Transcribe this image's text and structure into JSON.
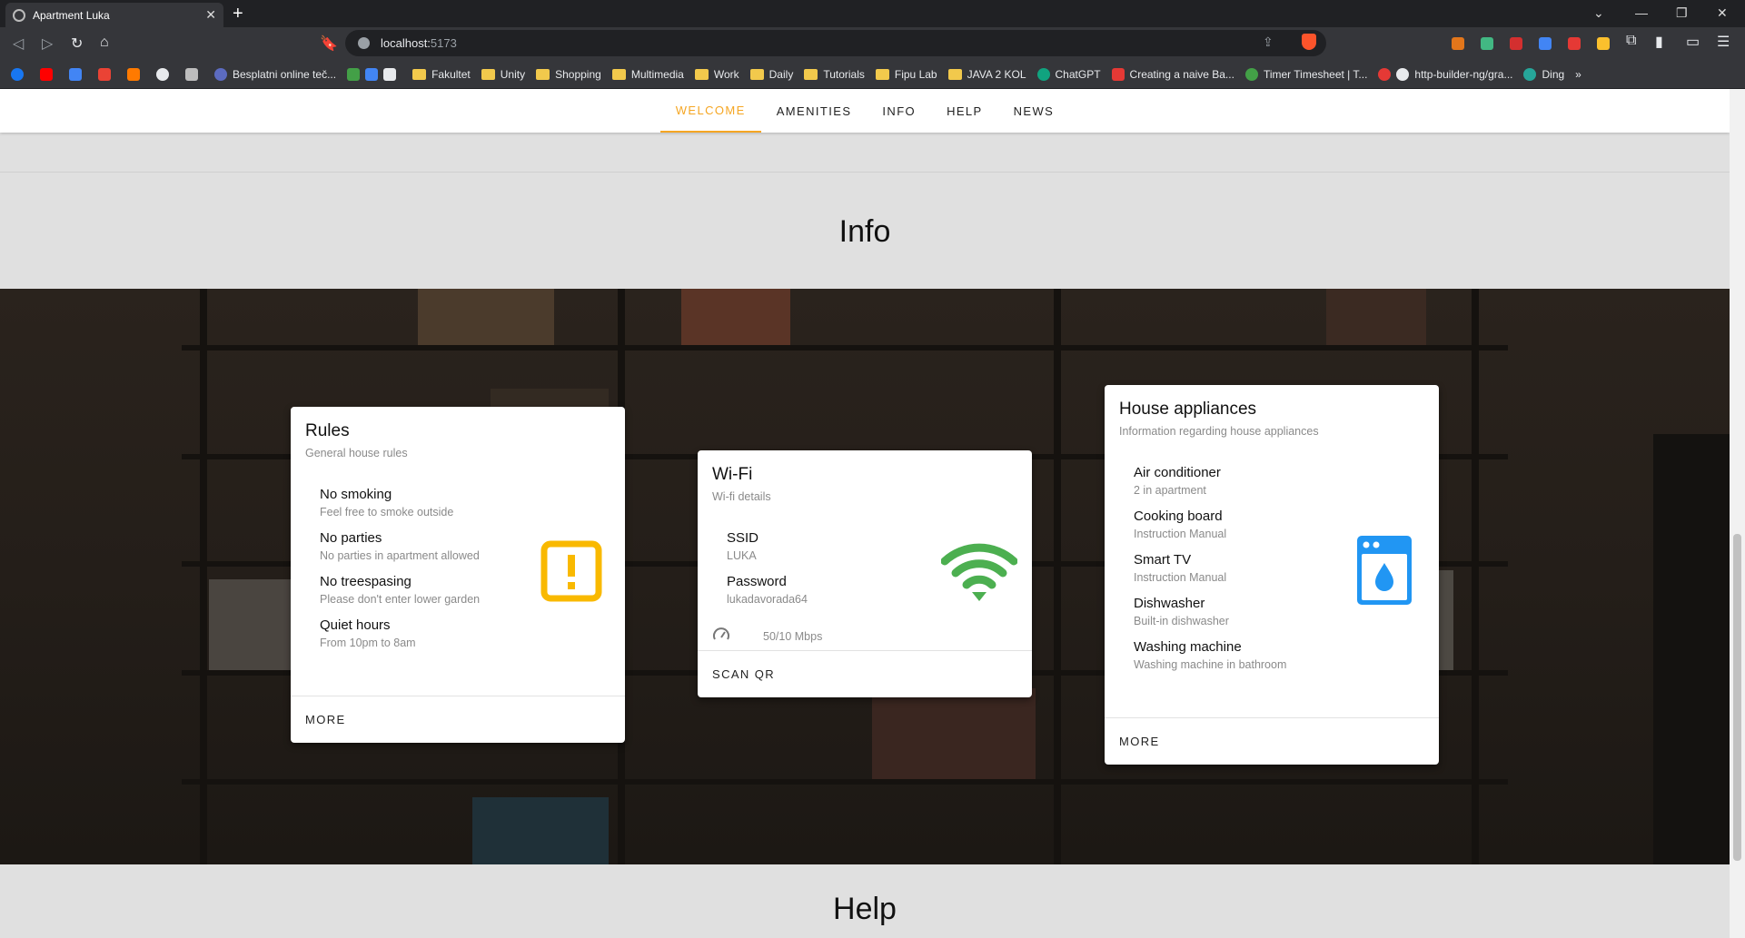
{
  "browser": {
    "tab_title": "Apartment Luka",
    "url_host": "localhost:",
    "url_port": "5173",
    "bookmarks": [
      {
        "label": "Besplatni online teč...",
        "kind": "site",
        "color": "#5c6bc0"
      },
      {
        "label": "Fakultet",
        "kind": "folder"
      },
      {
        "label": "Unity",
        "kind": "folder"
      },
      {
        "label": "Shopping",
        "kind": "folder"
      },
      {
        "label": "Multimedia",
        "kind": "folder"
      },
      {
        "label": "Work",
        "kind": "folder"
      },
      {
        "label": "Daily",
        "kind": "folder"
      },
      {
        "label": "Tutorials",
        "kind": "folder"
      },
      {
        "label": "Fipu Lab",
        "kind": "folder"
      },
      {
        "label": "JAVA 2 KOL",
        "kind": "folder"
      },
      {
        "label": "ChatGPT",
        "kind": "site",
        "color": "#10a37f"
      },
      {
        "label": "Creating a naive Ba...",
        "kind": "site",
        "color": "#e53935"
      },
      {
        "label": "Timer Timesheet | T...",
        "kind": "site",
        "color": "#43a047"
      },
      {
        "label": "http-builder-ng/gra...",
        "kind": "site",
        "color": "#eeeeee"
      },
      {
        "label": "Ding",
        "kind": "site",
        "color": "#26a69a"
      }
    ]
  },
  "nav": {
    "tabs": [
      "WELCOME",
      "AMENITIES",
      "INFO",
      "HELP",
      "NEWS"
    ],
    "active": "WELCOME"
  },
  "sections": {
    "info_title": "Info",
    "help_title": "Help"
  },
  "cards": {
    "rules": {
      "title": "Rules",
      "subtitle": "General house rules",
      "items": [
        {
          "title": "No smoking",
          "subtitle": "Feel free to smoke outside"
        },
        {
          "title": "No parties",
          "subtitle": "No parties in apartment allowed"
        },
        {
          "title": "No treespasing",
          "subtitle": "Please don't enter lower garden"
        },
        {
          "title": "Quiet hours",
          "subtitle": "From 10pm to 8am"
        }
      ],
      "icon": "alert-box-icon",
      "icon_color": "#f9b900",
      "action": "MORE"
    },
    "wifi": {
      "title": "Wi-Fi",
      "subtitle": "Wi-fi details",
      "items": [
        {
          "title": "SSID",
          "subtitle": "LUKA"
        },
        {
          "title": "Password",
          "subtitle": "lukadavorada64"
        }
      ],
      "speed": "50/10 Mbps",
      "icon": "wifi-icon",
      "icon_color": "#4caf50",
      "action": "SCAN QR"
    },
    "appliances": {
      "title": "House appliances",
      "subtitle": "Information regarding house appliances",
      "items": [
        {
          "title": "Air conditioner",
          "subtitle": "2 in apartment"
        },
        {
          "title": "Cooking board",
          "subtitle": "Instruction Manual"
        },
        {
          "title": "Smart TV",
          "subtitle": "Instruction Manual"
        },
        {
          "title": "Dishwasher",
          "subtitle": "Built-in dishwasher"
        },
        {
          "title": "Washing machine",
          "subtitle": "Washing machine in bathroom"
        }
      ],
      "icon": "washing-machine-icon",
      "icon_color": "#2196f3",
      "action": "MORE"
    }
  }
}
